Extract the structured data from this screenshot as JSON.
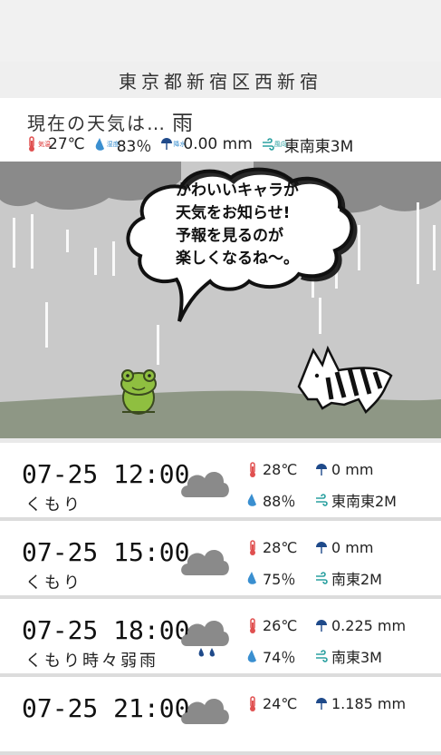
{
  "location": "東京都新宿区西新宿",
  "current": {
    "label": "現在の天気は…",
    "condition": "雨",
    "temp_label": "気温",
    "temp": "27℃",
    "humidity_label": "湿度",
    "humidity": "83％",
    "precip_label": "降水",
    "precip": "0.00 mm",
    "wind_label": "風向",
    "wind": "東南東3M"
  },
  "bubble": {
    "line1": "かわいいキャラが",
    "line2": "天気をお知らせ!",
    "line3": "予報を見るのが",
    "line4": "楽しくなるね～。"
  },
  "forecasts": [
    {
      "time": "07-25 12:00",
      "condition": "くもり",
      "icon": "cloud-icon",
      "temp": "28℃",
      "precip": "0 mm",
      "humidity": "88％",
      "wind": "東南東2M"
    },
    {
      "time": "07-25 15:00",
      "condition": "くもり",
      "icon": "cloud-icon",
      "temp": "28℃",
      "precip": "0 mm",
      "humidity": "75％",
      "wind": "南東2M"
    },
    {
      "time": "07-25 18:00",
      "condition": "くもり時々弱雨",
      "icon": "cloud-rain-icon",
      "temp": "26℃",
      "precip": "0.225 mm",
      "humidity": "74％",
      "wind": "南東3M"
    },
    {
      "time": "07-25 21:00",
      "condition": "",
      "icon": "cloud-rain-icon",
      "temp": "24℃",
      "precip": "1.185 mm",
      "humidity": "",
      "wind": ""
    }
  ],
  "colors": {
    "thermo": "#e05050",
    "drop": "#3a8fd0",
    "wind": "#2aa0a0",
    "umbrella": "#1f4a8a",
    "cloud": "#888888"
  }
}
